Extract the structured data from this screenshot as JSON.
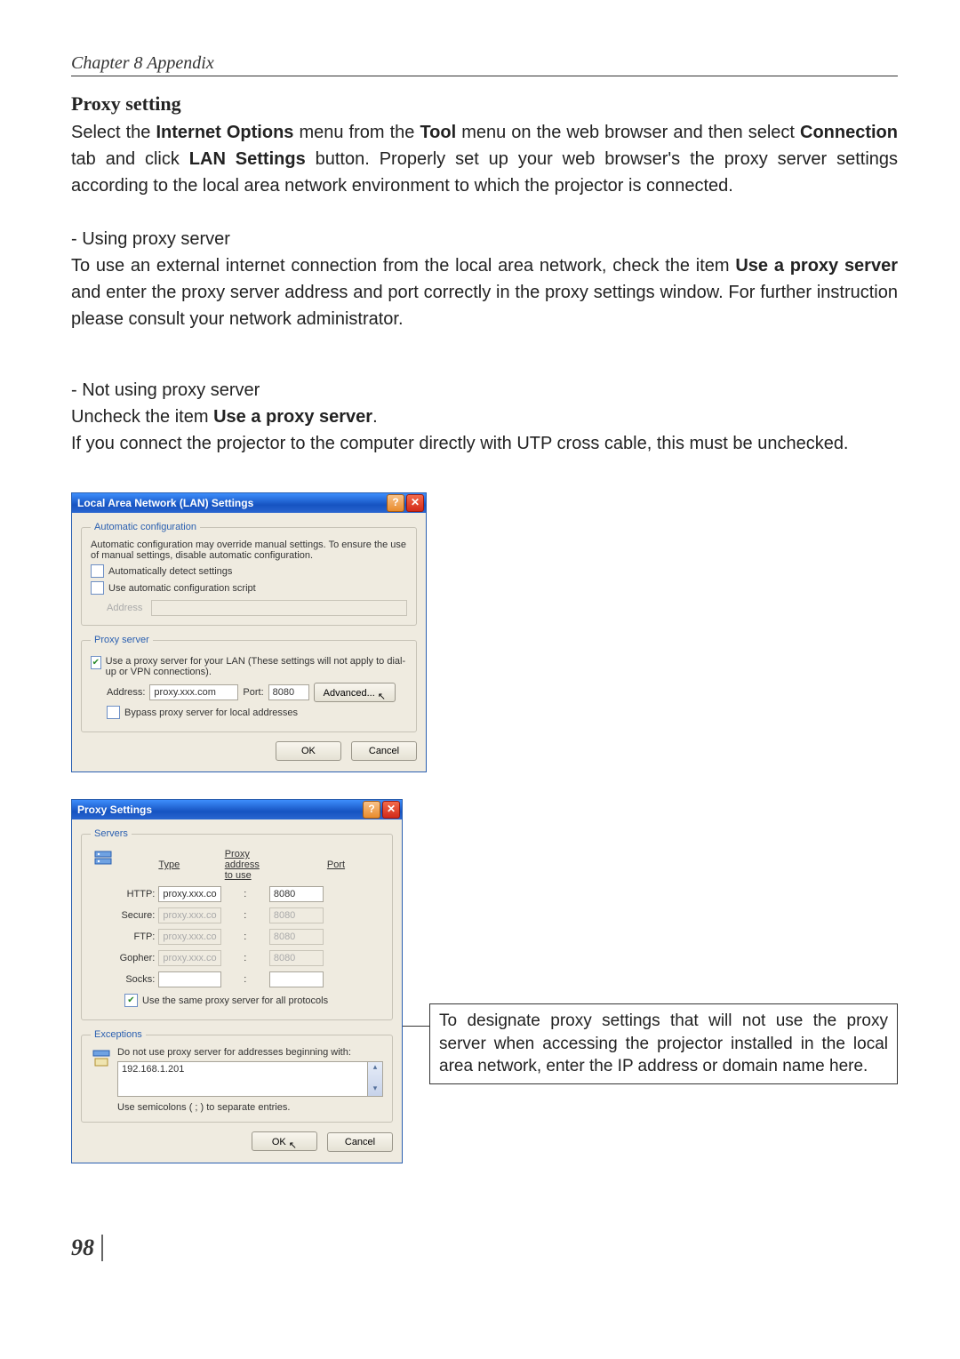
{
  "chapter": "Chapter 8 Appendix",
  "h_proxy": "Proxy setting",
  "p1_a": "Select the ",
  "p1_b": "Internet Options",
  "p1_c": " menu from the ",
  "p1_d": "Tool",
  "p1_e": " menu on the web browser and then select ",
  "p1_f": "Connection",
  "p1_g": " tab and click ",
  "p1_h": "LAN Settings",
  "p1_i": " button. Properly set up your web browser's the proxy server settings according to the local area network environment to which the projector is connected.",
  "h_using": "- Using proxy server",
  "p2_a": "To use an external internet connection from the local area network, check the item ",
  "p2_b": "Use a proxy server",
  "p2_c": " and enter the proxy server address and port correctly in the proxy settings window. For further instruction please consult your network administrator.",
  "h_notusing": "- Not using proxy server",
  "p3_a": "Uncheck the item ",
  "p3_b": "Use a proxy server",
  "p3_c": ".",
  "p3_d": "If you connect the projector to the computer directly with UTP cross cable, this must be unchecked.",
  "lan": {
    "title": "Local Area Network (LAN) Settings",
    "grp_auto": "Automatic configuration",
    "auto_txt": "Automatic configuration may override manual settings.  To ensure the use of manual settings, disable automatic configuration.",
    "chk_auto_detect": "Automatically detect settings",
    "chk_auto_script": "Use automatic configuration script",
    "lbl_address": "Address",
    "grp_proxy": "Proxy server",
    "chk_use_proxy": "Use a proxy server for your LAN (These settings will not apply to dial-up or VPN connections).",
    "lbl_addr": "Address:",
    "val_addr": "proxy.xxx.com",
    "lbl_port": "Port:",
    "val_port": "8080",
    "btn_adv": "Advanced...",
    "chk_bypass": "Bypass proxy server for local addresses",
    "btn_ok": "OK",
    "btn_cancel": "Cancel"
  },
  "ps": {
    "title": "Proxy Settings",
    "grp_servers": "Servers",
    "hdr_type": "Type",
    "hdr_addr": "Proxy address to use",
    "hdr_port": "Port",
    "rows": [
      {
        "type": "HTTP:",
        "addr": "proxy.xxx.com",
        "port": "8080",
        "dis": false
      },
      {
        "type": "Secure:",
        "addr": "proxy.xxx.com",
        "port": "8080",
        "dis": true
      },
      {
        "type": "FTP:",
        "addr": "proxy.xxx.com",
        "port": "8080",
        "dis": true
      },
      {
        "type": "Gopher:",
        "addr": "proxy.xxx.com",
        "port": "8080",
        "dis": true
      },
      {
        "type": "Socks:",
        "addr": "",
        "port": "",
        "dis": false
      }
    ],
    "chk_same": "Use the same proxy server for all protocols",
    "grp_exc": "Exceptions",
    "exc_lbl": "Do not use proxy server for addresses beginning with:",
    "exc_val": "192.168.1.201",
    "exc_hint": "Use semicolons ( ; ) to separate entries.",
    "btn_ok": "OK",
    "btn_cancel": "Cancel"
  },
  "note": "To designate proxy settings that will not use the proxy server when accessing the projector installed in the local area network, enter the IP address or domain name here.",
  "page_num": "98",
  "glyph_help": "?",
  "glyph_close": "✕",
  "glyph_check": "✔",
  "glyph_up": "▴",
  "glyph_down": "▾",
  "glyph_cursor": "↖"
}
